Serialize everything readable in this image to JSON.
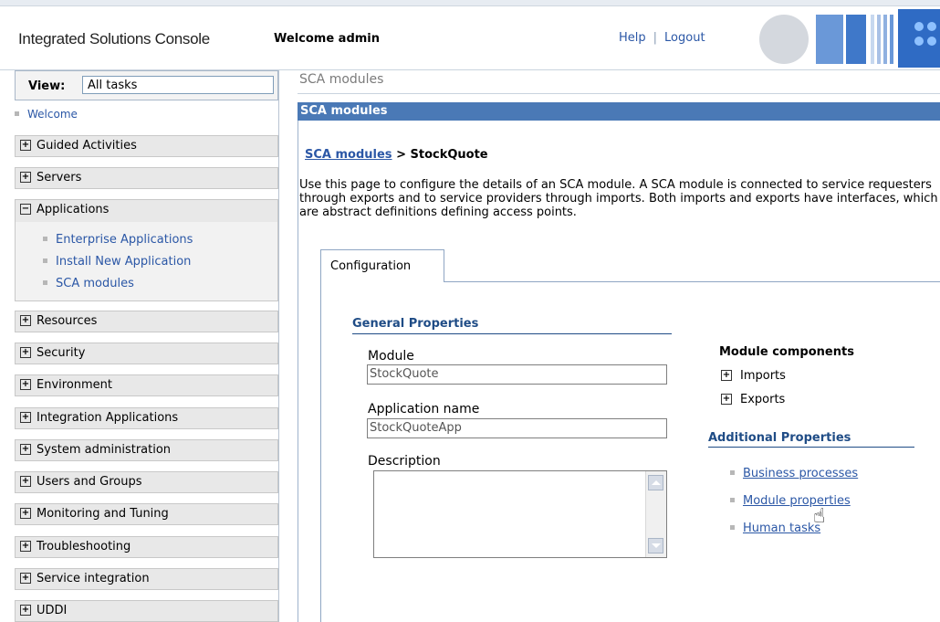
{
  "header": {
    "console_title": "Integrated Solutions Console",
    "welcome": "Welcome admin",
    "help_link": "Help",
    "separator": "|",
    "logout_link": "Logout"
  },
  "sidebar": {
    "view_label": "View:",
    "view_value": "All tasks",
    "welcome_link": "Welcome",
    "items": [
      {
        "label": "Guided Activities",
        "state": "+"
      },
      {
        "label": "Servers",
        "state": "+"
      },
      {
        "label": "Applications",
        "state": "−"
      },
      {
        "label": "Resources",
        "state": "+"
      },
      {
        "label": "Security",
        "state": "+"
      },
      {
        "label": "Environment",
        "state": "+"
      },
      {
        "label": "Integration Applications",
        "state": "+"
      },
      {
        "label": "System administration",
        "state": "+"
      },
      {
        "label": "Users and Groups",
        "state": "+"
      },
      {
        "label": "Monitoring and Tuning",
        "state": "+"
      },
      {
        "label": "Troubleshooting",
        "state": "+"
      },
      {
        "label": "Service integration",
        "state": "+"
      },
      {
        "label": "UDDI",
        "state": "+"
      }
    ],
    "applications_sub": [
      "Enterprise Applications",
      "Install New Application",
      "SCA modules"
    ]
  },
  "main": {
    "page_crumb": "SCA modules",
    "portlet_title": "SCA modules",
    "breadcrumb_link": "SCA modules",
    "breadcrumb_sep": " > ",
    "breadcrumb_current": "StockQuote",
    "description": "Use this page to configure the details of an SCA module. A SCA module is connected to service requesters through exports and to service providers through imports. Both imports and exports have interfaces, which are abstract definitions defining access points.",
    "tab_label": "Configuration",
    "general_properties_title": "General Properties",
    "module_label": "Module",
    "module_value": "StockQuote",
    "app_name_label": "Application name",
    "app_name_value": "StockQuoteApp",
    "description_label": "Description",
    "module_components_title": "Module components",
    "components": [
      "Imports",
      "Exports"
    ],
    "additional_properties_title": "Additional Properties",
    "additional_links": [
      "Business processes",
      "Module properties",
      "Human tasks"
    ]
  }
}
